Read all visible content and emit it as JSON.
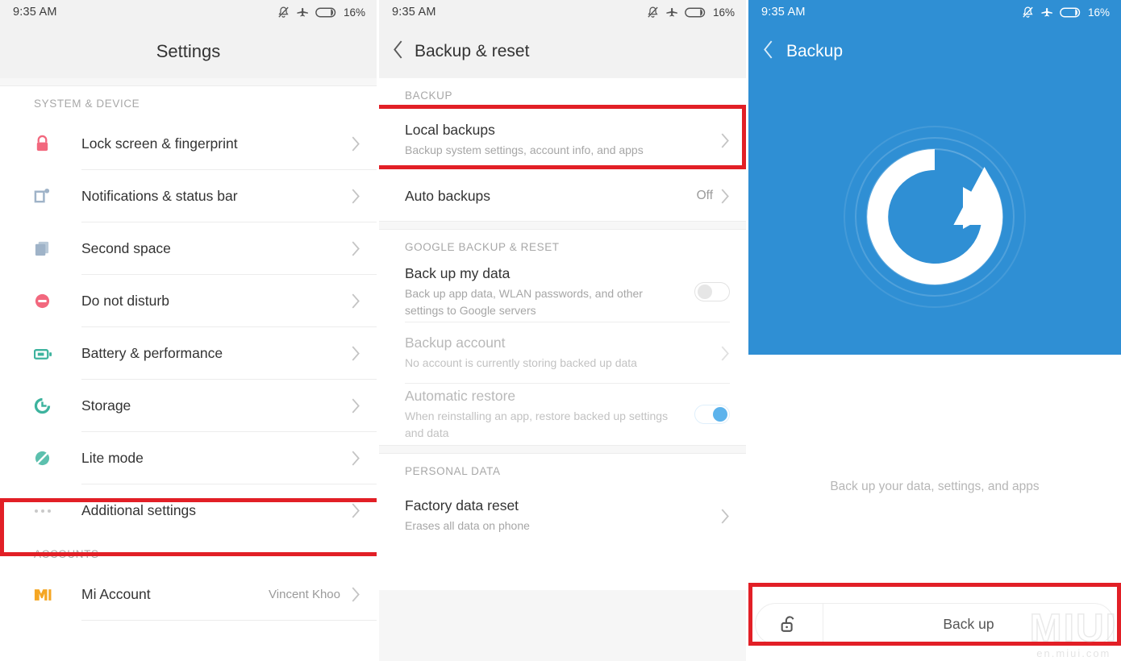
{
  "status_bar": {
    "time": "9:35 AM",
    "battery_percent": "16%",
    "icons": [
      "mute-bell-icon",
      "airplane-mode-icon",
      "battery-icon"
    ]
  },
  "colors": {
    "accent_blue": "#2f8fd4",
    "highlight_red": "#e21f26",
    "toggle_on": "#5cb3ec",
    "icon_pink": "#f2687e",
    "icon_blue_grey": "#9fb3c8",
    "icon_teal": "#3db39e",
    "mi_orange": "#f5a623"
  },
  "settings_screen": {
    "title": "Settings",
    "sections": [
      {
        "label": "SYSTEM & DEVICE",
        "items": [
          {
            "label": "Lock screen & fingerprint",
            "icon": "lock-icon",
            "value": ""
          },
          {
            "label": "Notifications & status bar",
            "icon": "notification-icon",
            "value": ""
          },
          {
            "label": "Second space",
            "icon": "second-space-icon",
            "value": ""
          },
          {
            "label": "Do not disturb",
            "icon": "do-not-disturb-icon",
            "value": ""
          },
          {
            "label": "Battery & performance",
            "icon": "battery-icon",
            "value": ""
          },
          {
            "label": "Storage",
            "icon": "storage-icon",
            "value": ""
          },
          {
            "label": "Lite mode",
            "icon": "lite-mode-icon",
            "value": ""
          },
          {
            "label": "Additional settings",
            "icon": "more-dots-icon",
            "value": ""
          }
        ]
      },
      {
        "label": "ACCOUNTS",
        "items": [
          {
            "label": "Mi Account",
            "icon": "mi-logo-icon",
            "value": "Vincent Khoo"
          }
        ]
      }
    ],
    "highlighted_item": "Additional settings"
  },
  "backup_reset_screen": {
    "title": "Backup  &  reset",
    "back_icon": "chevron-left-icon",
    "sections": [
      {
        "label": "BACKUP",
        "items": [
          {
            "title": "Local backups",
            "subtitle": "Backup system settings, account info, and apps",
            "value": "",
            "control": "chevron",
            "dim": false
          },
          {
            "title": "Auto backups",
            "subtitle": "",
            "value": "Off",
            "control": "chevron",
            "dim": false
          }
        ]
      },
      {
        "label": "GOOGLE BACKUP & RESET",
        "items": [
          {
            "title": "Back up my data",
            "subtitle": "Back up app data, WLAN passwords, and other settings to Google servers",
            "value": "",
            "control": "toggle-off",
            "dim": false
          },
          {
            "title": "Backup account",
            "subtitle": "No account is currently storing backed up data",
            "value": "",
            "control": "chevron",
            "dim": true
          },
          {
            "title": "Automatic restore",
            "subtitle": "When reinstalling an app, restore backed up settings and data",
            "value": "",
            "control": "toggle-on",
            "dim": true
          }
        ]
      },
      {
        "label": "PERSONAL DATA",
        "items": [
          {
            "title": "Factory data reset",
            "subtitle": "Erases all data on phone",
            "value": "",
            "control": "chevron",
            "dim": false
          }
        ]
      }
    ],
    "highlighted_item": "Local backups"
  },
  "backup_screen": {
    "title": "Backup",
    "back_icon": "chevron-left-icon",
    "hero_icon": "backup-restore-circle-icon",
    "caption": "Back up your data, settings, and apps",
    "action_button": {
      "label": "Back up",
      "icon": "unlock-padlock-icon"
    },
    "highlighted_item": "Back up"
  },
  "watermark": {
    "main": "MIUI",
    "sub": "en.miui.com"
  }
}
